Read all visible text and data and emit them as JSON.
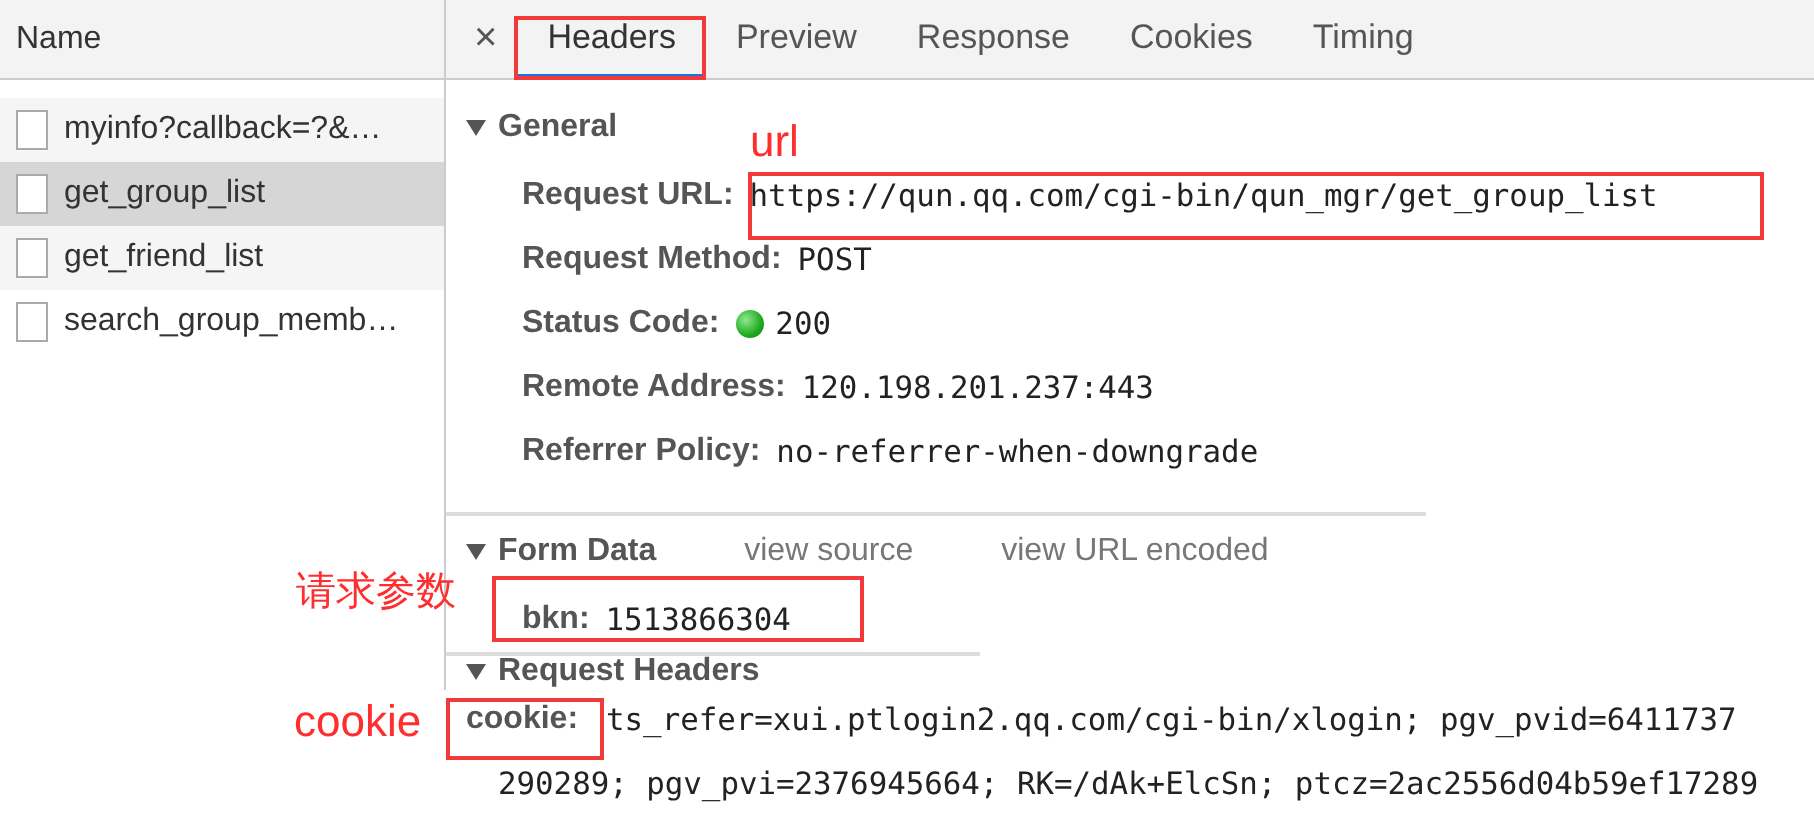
{
  "sidebar": {
    "header": "Name",
    "items": [
      {
        "name": "myinfo?callback=?&…",
        "selected": false
      },
      {
        "name": "get_group_list",
        "selected": true
      },
      {
        "name": "get_friend_list",
        "selected": false
      },
      {
        "name": "search_group_memb…",
        "selected": false
      }
    ]
  },
  "detail": {
    "close": "×",
    "tabs": [
      {
        "label": "Headers",
        "selected": true
      },
      {
        "label": "Preview",
        "selected": false
      },
      {
        "label": "Response",
        "selected": false
      },
      {
        "label": "Cookies",
        "selected": false
      },
      {
        "label": "Timing",
        "selected": false
      }
    ],
    "sections": [
      {
        "title": "General",
        "expanded": true,
        "rows": [
          {
            "kind": "text",
            "label": "Request URL:",
            "value": "https://qun.qq.com/cgi-bin/qun_mgr/get_group_list"
          },
          {
            "kind": "text",
            "label": "Request Method:",
            "value": "POST"
          },
          {
            "kind": "status",
            "label": "Status Code:",
            "value": "200"
          },
          {
            "kind": "text",
            "label": "Remote Address:",
            "value": "120.198.201.237:443"
          },
          {
            "kind": "text",
            "label": "Referrer Policy:",
            "value": "no-referrer-when-downgrade"
          }
        ]
      },
      {
        "title": "Form Data",
        "expanded": true,
        "links": [
          "view source",
          "view URL encoded"
        ],
        "rows": [
          {
            "kind": "text",
            "label": "bkn:",
            "value": "1513866304"
          }
        ]
      },
      {
        "title": "Request Headers",
        "expanded": true,
        "rows": [
          {
            "kind": "multiline",
            "label": "cookie:",
            "lines": [
              "ts_refer=xui.ptlogin2.qq.com/cgi-bin/xlogin; pgv_pvid=6411737",
              "290289; pgv_pvi=2376945664; RK=/dAk+ElcSn; ptcz=2ac2556d04b59ef17289"
            ]
          }
        ]
      }
    ]
  },
  "annotations": [
    {
      "text": "url"
    },
    {
      "text": "请求参数"
    },
    {
      "text": "cookie"
    }
  ]
}
